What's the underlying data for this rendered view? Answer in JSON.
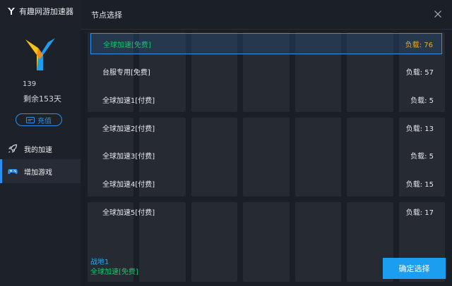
{
  "app": {
    "title": "有趣网游加速器"
  },
  "user": {
    "id": "139",
    "days_left": "剩余153天"
  },
  "sidebar": {
    "recharge_label": "充值",
    "items": [
      {
        "label": "我的加速"
      },
      {
        "label": "增加游戏"
      }
    ]
  },
  "dialog": {
    "title": "节点选择",
    "nodes": [
      {
        "name": "全球加速[免费]",
        "load": "负载: 76"
      },
      {
        "name": "台服专用[免费]",
        "load": "负载: 57"
      },
      {
        "name": "全球加速1[付费]",
        "load": "负载: 5"
      },
      {
        "name": "全球加速2[付费]",
        "load": "负载: 13"
      },
      {
        "name": "全球加速3[付费]",
        "load": "负载: 5"
      },
      {
        "name": "全球加速4[付费]",
        "load": "负载: 15"
      },
      {
        "name": "全球加速5[付费]",
        "load": "负载: 17"
      }
    ],
    "status_game": "战地1",
    "status_node": "全球加速[免费]",
    "confirm_label": "确定选择"
  },
  "colors": {
    "accent": "#1c9ef0",
    "selected_text": "#16c46a",
    "selected_load": "#f2a71b"
  }
}
